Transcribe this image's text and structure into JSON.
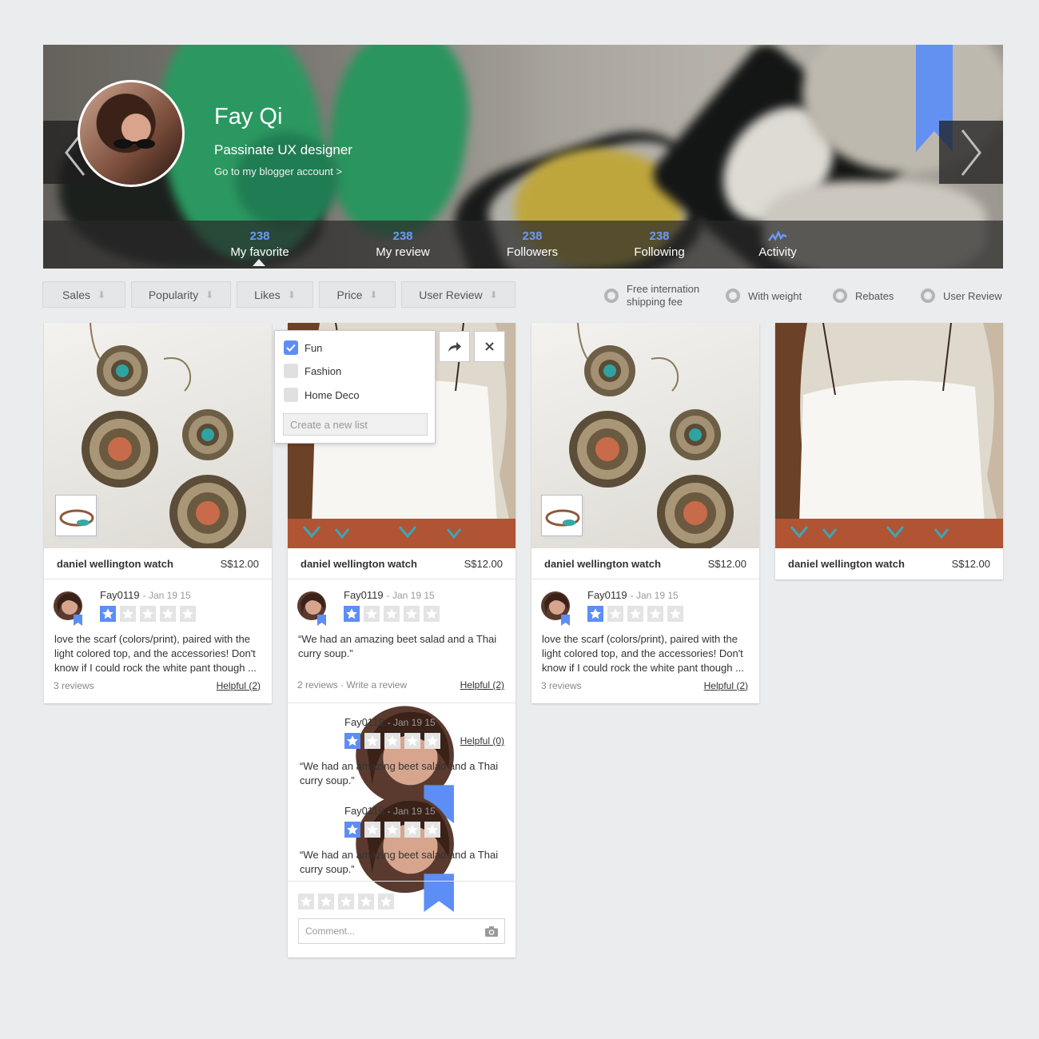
{
  "profile": {
    "name": "Fay Qi",
    "title": "Passinate UX designer",
    "blog_link": "Go to my blogger account >"
  },
  "stats": [
    {
      "count": "238",
      "label": "My favorite"
    },
    {
      "count": "238",
      "label": "My review"
    },
    {
      "count": "238",
      "label": "Followers"
    },
    {
      "count": "238",
      "label": "Following"
    },
    {
      "count": "",
      "label": "Activity"
    }
  ],
  "sort_buttons": [
    "Sales",
    "Popularity",
    "Likes",
    "Price",
    "User Review"
  ],
  "filters": [
    "Free internation shipping fee",
    "With weight",
    "Rebates",
    "User Review"
  ],
  "colors": {
    "accent": "#5d8ef5",
    "stat_number": "#6b9bf5",
    "background": "#ebecee"
  },
  "products": [
    {
      "name": "daniel wellington watch",
      "price": "S$12.00",
      "review": {
        "user": "Fay0119",
        "date": "- Jan 19 15",
        "rating": 1,
        "text": "love the scarf (colors/print), paired with the light colored top, and the accessories! Don't know if I could rock the white pant though ..."
      },
      "review_count": "3 reviews",
      "helpful": "Helpful (2)"
    },
    {
      "name": "daniel wellington watch",
      "price": "S$12.00",
      "review": {
        "user": "Fay0119",
        "date": "- Jan 19 15",
        "rating": 1,
        "text": "“We had an amazing beet salad and a Thai curry soup.”"
      },
      "review_count": "2 reviews · Write a review",
      "helpful": "Helpful (2)",
      "more_reviews": [
        {
          "user": "Fay0119",
          "date": "- Jan 19 15",
          "rating": 1,
          "text": "“We had an amazing beet salad and a Thai curry soup.”",
          "helpful": "Helpful (0)"
        },
        {
          "user": "Fay0119",
          "date": "- Jan 19 15",
          "rating": 1,
          "text": "“We had an amazing beet salad and a Thai curry soup.”"
        }
      ],
      "comment_placeholder": "Comment..."
    },
    {
      "name": "daniel wellington watch",
      "price": "S$12.00",
      "review": {
        "user": "Fay0119",
        "date": "- Jan 19 15",
        "rating": 1,
        "text": "love the scarf (colors/print), paired with the light colored top, and the accessories! Don't know if I could rock the white pant though ..."
      },
      "review_count": "3 reviews",
      "helpful": "Helpful (2)"
    },
    {
      "name": "daniel wellington watch",
      "price": "S$12.00"
    }
  ],
  "save_popover": {
    "lists": [
      {
        "label": "Fun",
        "checked": true
      },
      {
        "label": "Fashion",
        "checked": false
      },
      {
        "label": "Home Deco",
        "checked": false
      }
    ],
    "new_list_placeholder": "Create a new list"
  },
  "icons": [
    "chevron-left-icon",
    "chevron-right-icon",
    "bookmark-icon",
    "activity-icon",
    "sort-arrow-icon",
    "share-icon",
    "close-icon",
    "star-icon",
    "camera-icon",
    "check-icon"
  ]
}
